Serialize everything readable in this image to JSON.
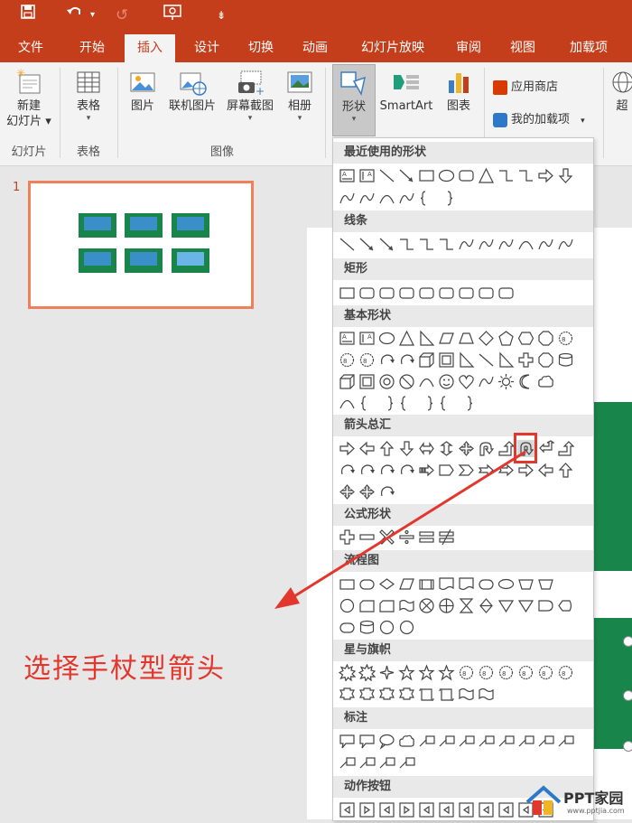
{
  "titlebar": {
    "save_icon": "save-icon",
    "undo_icon": "undo-icon",
    "redo_icon": "redo-icon",
    "presenter_icon": "start-from-beginning-icon",
    "customize_icon": "customize-toolbar-icon"
  },
  "tabs": [
    "文件",
    "开始",
    "插入",
    "设计",
    "切换",
    "动画",
    "幻灯片放映",
    "审阅",
    "视图",
    "加载项"
  ],
  "ribbon": {
    "new_slide": "新建",
    "new_slide2": "幻灯片",
    "table": "表格",
    "picture": "图片",
    "online_picture": "联机图片",
    "screenshot": "屏幕截图",
    "album": "相册",
    "shapes": "形状",
    "smartart": "SmartArt",
    "chart": "图表",
    "store": "应用商店",
    "my_addins": "我的加载项",
    "super": "超",
    "group_slides": "幻灯片",
    "group_tables": "表格",
    "group_images": "图像"
  },
  "slide_panel": {
    "slide_number": "1"
  },
  "shapes_menu": {
    "recent": "最近使用的形状",
    "lines": "线条",
    "rect": "矩形",
    "basic": "基本形状",
    "arrows": "箭头总汇",
    "equation": "公式形状",
    "flowchart": "流程图",
    "stars": "星与旗帜",
    "callouts": "标注",
    "action": "动作按钮"
  },
  "annotation": "选择手杖型箭头",
  "watermark": {
    "brand": "PPT家园",
    "url": "www.pptjia.com"
  },
  "colors": {
    "accent": "#c43e1c",
    "highlight": "#e2372d",
    "green": "#18864a"
  }
}
